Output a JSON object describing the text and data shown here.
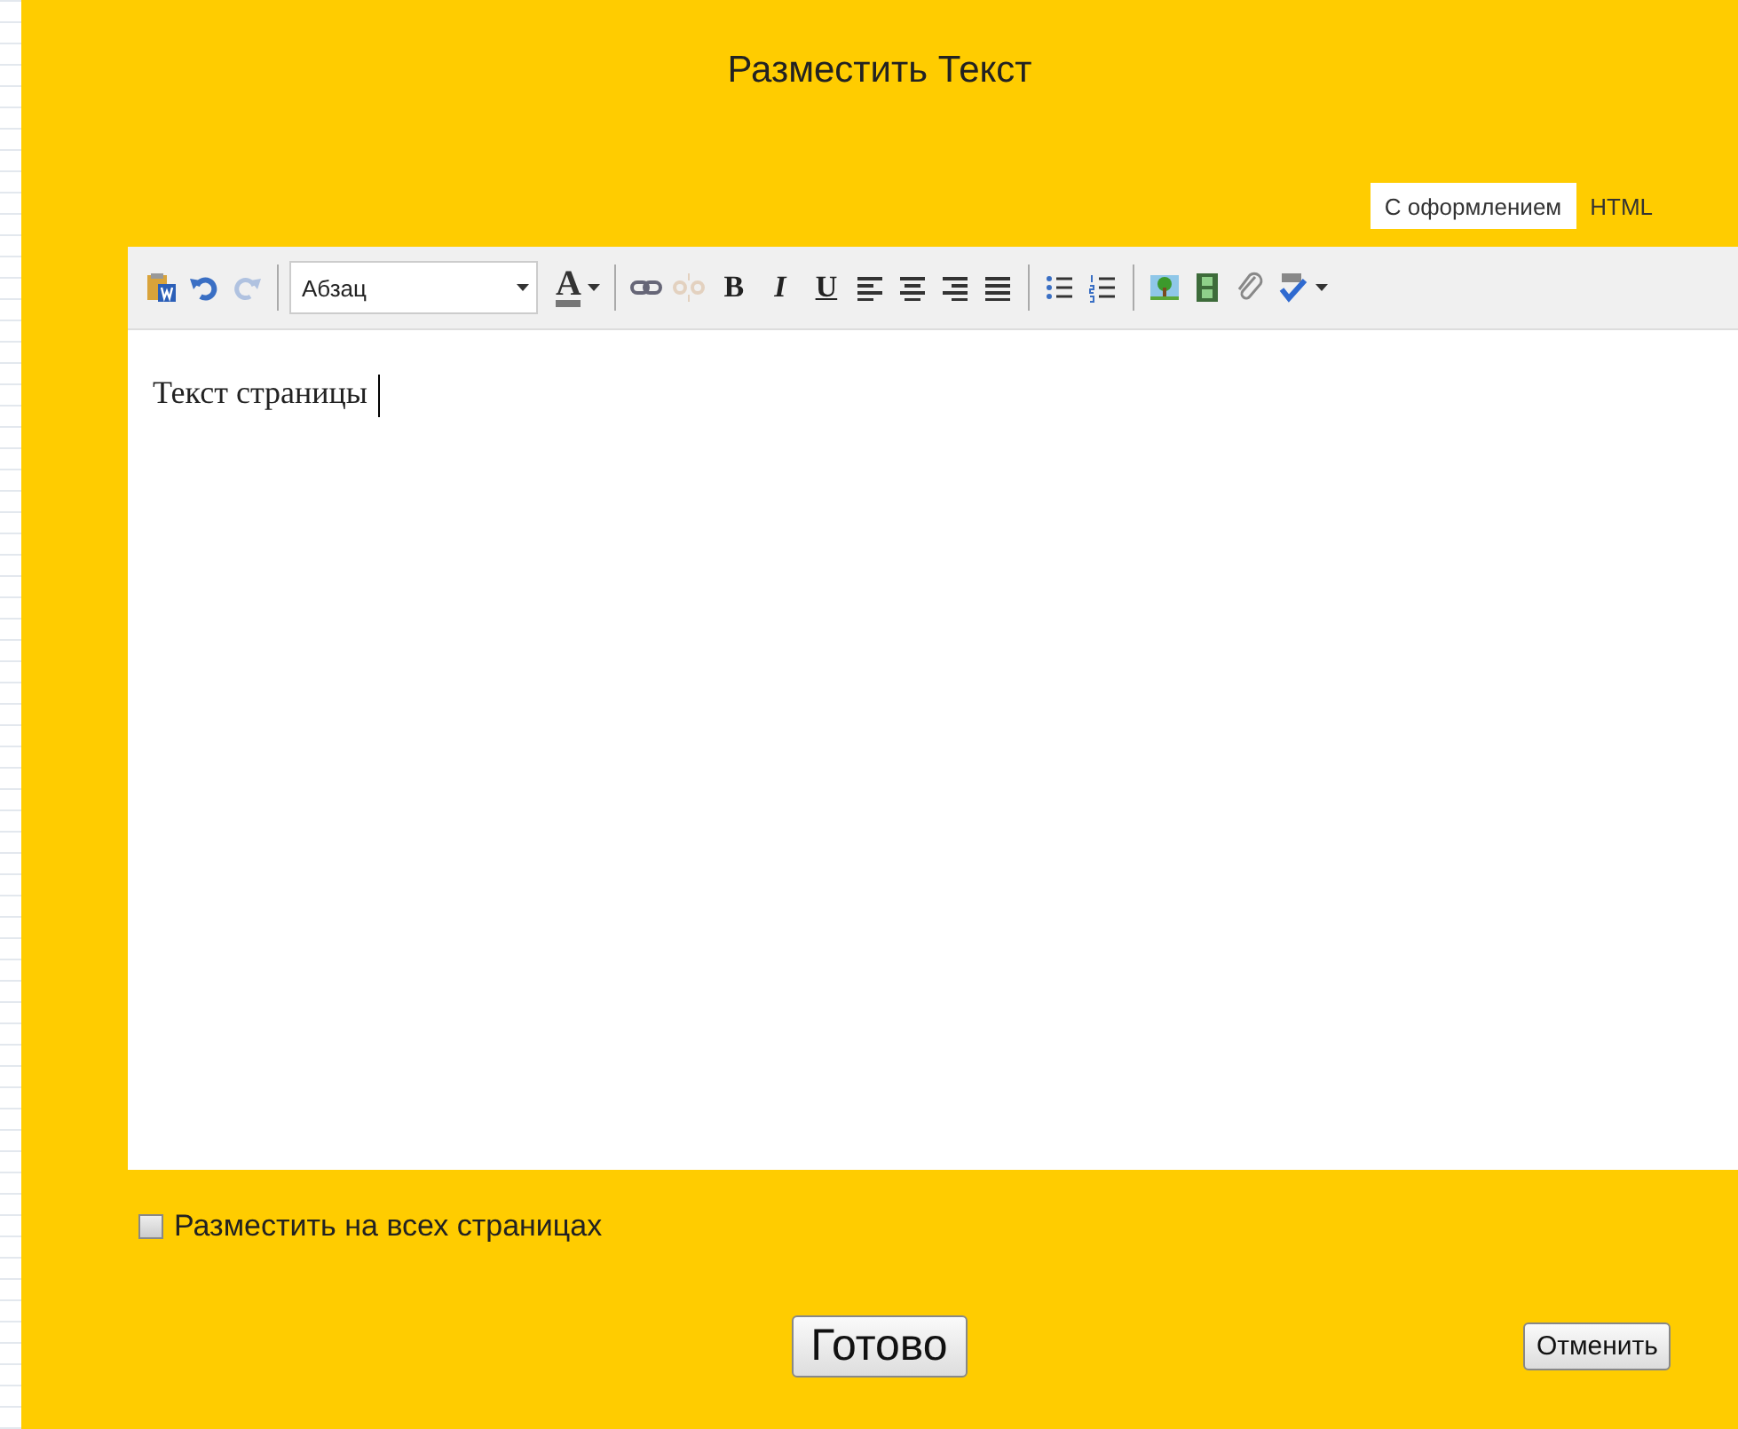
{
  "dialog": {
    "title": "Разместить Текст"
  },
  "tabs": [
    {
      "label": "С оформлением",
      "selected": true
    },
    {
      "label": "HTML",
      "selected": false
    }
  ],
  "toolbar": [
    {
      "kind": "icon",
      "disabled": false
    },
    {
      "kind": "icon",
      "disabled": false
    },
    {
      "kind": "icon",
      "disabled": true
    },
    {
      "kind": "separator"
    },
    {
      "kind": "select",
      "value": "Абзац"
    },
    {
      "kind": "color",
      "text": "A",
      "dropdown": true
    },
    {
      "kind": "separator"
    },
    {
      "kind": "icon",
      "disabled": false
    },
    {
      "kind": "icon",
      "disabled": true
    },
    {
      "kind": "glyph",
      "text": "B"
    },
    {
      "kind": "glyph",
      "text": "I"
    },
    {
      "kind": "glyph",
      "text": "U"
    },
    {
      "kind": "icon",
      "disabled": false
    },
    {
      "kind": "icon",
      "disabled": false
    },
    {
      "kind": "icon",
      "disabled": false
    },
    {
      "kind": "icon",
      "disabled": false
    },
    {
      "kind": "separator"
    },
    {
      "kind": "icon",
      "disabled": false
    },
    {
      "kind": "icon",
      "disabled": false
    },
    {
      "kind": "separator"
    },
    {
      "kind": "icon",
      "disabled": false
    },
    {
      "kind": "icon",
      "disabled": false
    },
    {
      "kind": "icon",
      "disabled": false
    },
    {
      "kind": "icon",
      "disabled": false,
      "dropdown": true
    }
  ],
  "editor": {
    "value": "Текст страницы"
  },
  "checkbox": {
    "label": "Разместить на всех страницах",
    "checked": false
  },
  "buttons": [
    {
      "label": "Готово",
      "kind": "primary"
    },
    {
      "label": "Отменить",
      "kind": "secondary"
    }
  ]
}
